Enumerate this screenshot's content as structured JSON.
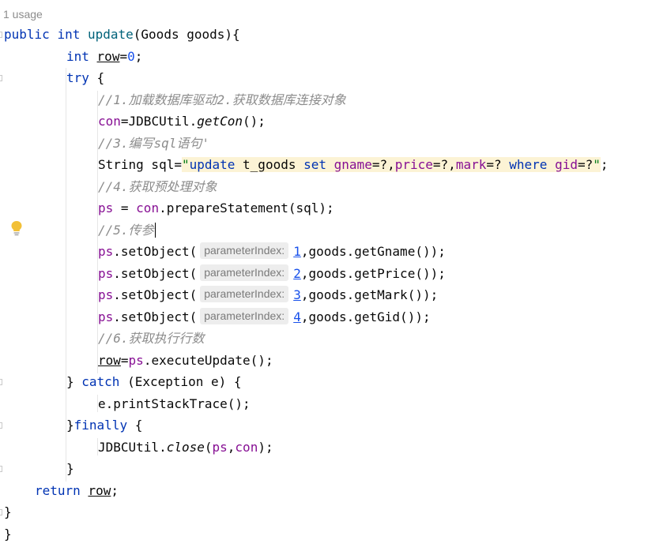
{
  "usage_hint": "1 usage",
  "hint_label": "parameterIndex:",
  "tokens": {
    "public": "public",
    "int": "int",
    "update": "update",
    "sig_rest": "(Goods goods){",
    "row": "row",
    "eq": "=",
    "zero": "0",
    "semi": ";",
    "try": "try",
    "open_brace": " {",
    "close_brace": "}",
    "comment1": "//1.加载数据库驱动2.获取数据库连接对象",
    "con": "con",
    "eq_jdbc": "=JDBCUtil.",
    "getCon": "getCon",
    "call_end": "();",
    "comment3": "//3.编写sql语句'",
    "string_decl": "String sql=",
    "quote": "\"",
    "sql_update": "update",
    "sql_table": " t_goods ",
    "sql_set": "set",
    "sql_sp": " ",
    "sql_gname": "gname",
    "sql_q1": "=?,",
    "sql_price": "price",
    "sql_q2": "=?,",
    "sql_mark": "mark",
    "sql_q3": "=? ",
    "sql_where": "where",
    "sql_gid": "gid",
    "sql_q4": "=?",
    "comment4": "//4.获取预处理对象",
    "ps": "ps",
    "ps_assign": " = ",
    "con_prepare": ".prepareStatement(sql);",
    "comment5": "//5.传参",
    "setObject": ".setObject(",
    "idx1": "1",
    "idx2": "2",
    "idx3": "3",
    "idx4": "4",
    "arg1": ",goods.getGname());",
    "arg2": ",goods.getPrice());",
    "arg3": ",goods.getMark());",
    "arg4": ",goods.getGid());",
    "comment6": "//6.获取执行行数",
    "eq_plain": "=",
    "exec_update": ".executeUpdate();",
    "catch_open": "} ",
    "catch": "catch",
    "catch_rest": " (Exception e) {",
    "print_trace": "e.printStackTrace();",
    "finally_open": "}",
    "finally": "finally",
    "jdbc_close_start": "JDBCUtil.",
    "close": "close",
    "paren_open": "(",
    "comma": ",",
    "paren_close": ");",
    "return": "return",
    "return_sp": " "
  }
}
